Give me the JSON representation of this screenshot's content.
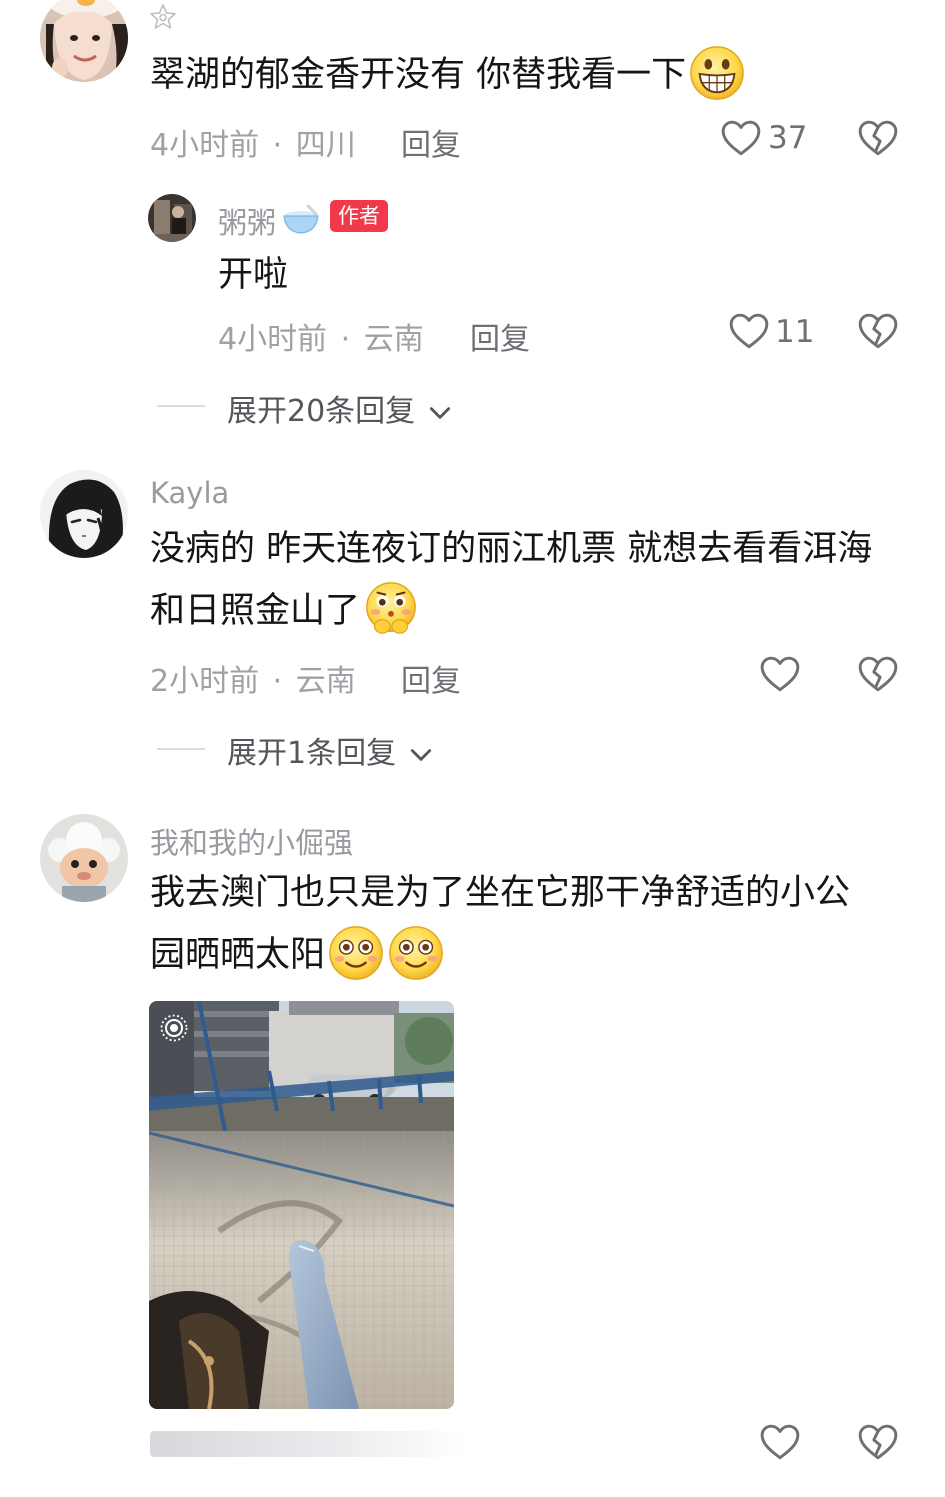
{
  "comments": [
    {
      "text": "翠湖的郁金香开没有 你替我看一下",
      "time": "4小时前",
      "region": "四川",
      "reply_label": "回复",
      "likes": "37"
    },
    {
      "author": "粥粥",
      "author_badge": "作者",
      "text": "开啦",
      "time": "4小时前",
      "region": "云南",
      "reply_label": "回复",
      "likes": "11",
      "expand_label": "展开20条回复"
    },
    {
      "author": "Kayla",
      "text_line1": "没病的 昨天连夜订的丽江机票 就想去看看洱海",
      "text_line2": "和日照金山了",
      "time": "2小时前",
      "region": "云南",
      "reply_label": "回复",
      "expand_label": "展开1条回复"
    },
    {
      "author": "我和我的小倔强",
      "text_line1": "我去澳门也只是为了坐在它那干净舒适的小公",
      "text_line2": "园晒晒太阳"
    }
  ],
  "meta_separator": "·",
  "icons": {
    "like": "heart-outline-icon",
    "dislike": "broken-heart-icon",
    "expand": "chevron-down-icon",
    "live_photo": "live-photo-icon",
    "emoji_grin": "grinning-emoji",
    "emoji_shy": "shy-emoji",
    "emoji_smile": "smiling-emoji"
  },
  "colors": {
    "author_badge": "#f0394b",
    "secondary_text": "#a0a0a6",
    "primary_text": "#151515"
  }
}
